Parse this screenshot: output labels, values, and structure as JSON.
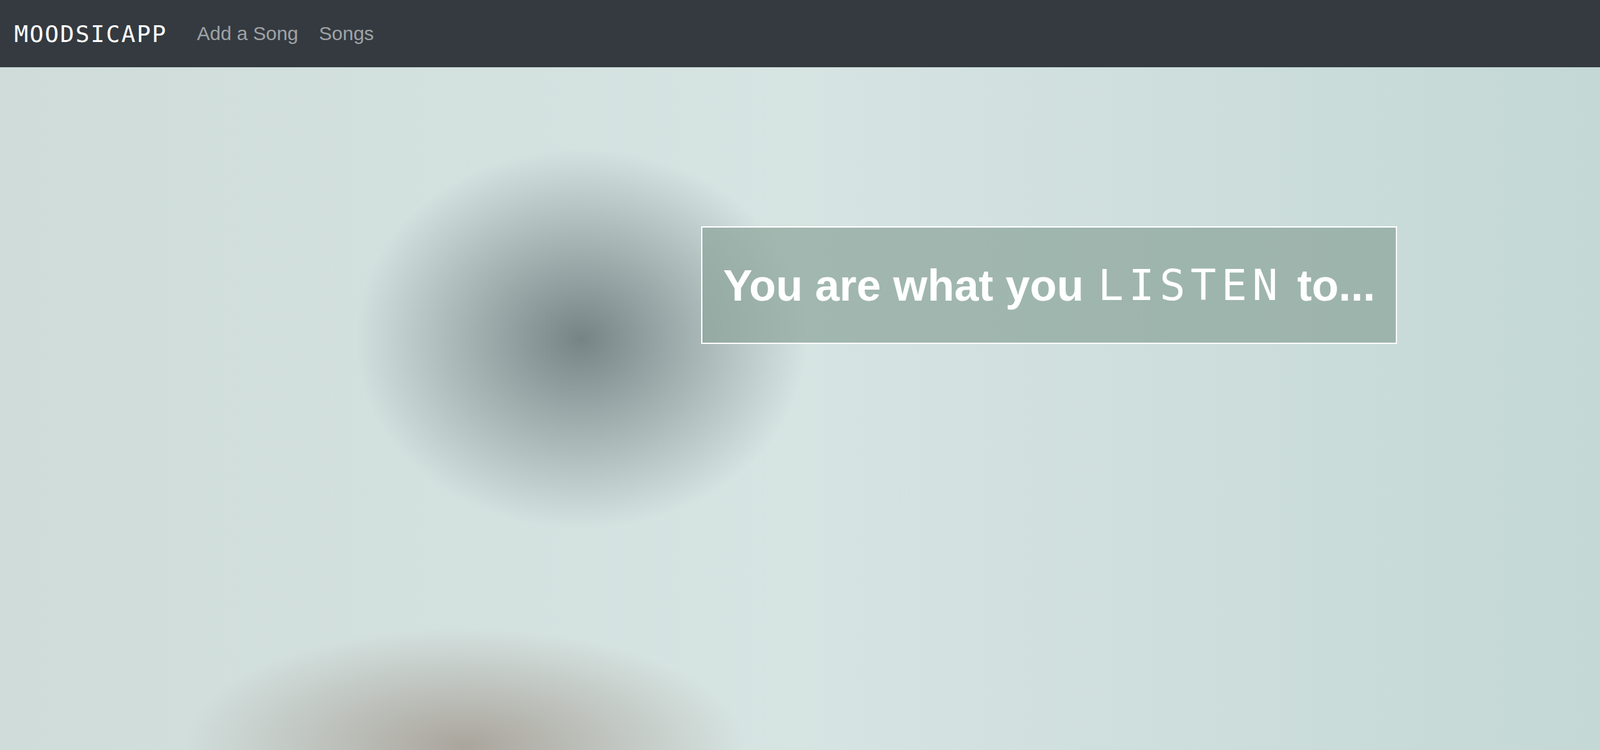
{
  "navbar": {
    "brand": "MOODSICAPP",
    "links": [
      {
        "label": "Add a Song"
      },
      {
        "label": "Songs"
      }
    ]
  },
  "hero": {
    "tagline": {
      "before": "You are what you",
      "emphasis": "LISTEN",
      "after": "to..."
    }
  }
}
